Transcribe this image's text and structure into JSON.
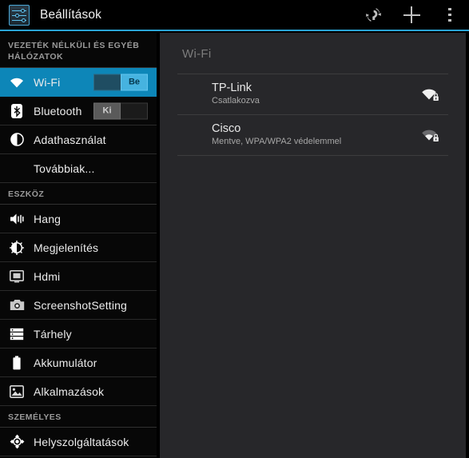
{
  "action_bar": {
    "app_icon": "settings-sliders-icon",
    "title": "Beállítások",
    "actions": [
      {
        "name": "scan-refresh-icon",
        "label": ""
      },
      {
        "name": "add-icon",
        "label": ""
      },
      {
        "name": "overflow-menu-icon",
        "label": ""
      }
    ]
  },
  "sidebar": {
    "sections": [
      {
        "header": "VEZETÉK NÉLKÜLI ÉS EGYÉB HÁLÓZATOK",
        "items": [
          {
            "label": "Wi-Fi",
            "icon": "wifi-icon",
            "selected": true,
            "toggle": {
              "state": "on",
              "label": "Be"
            }
          },
          {
            "label": "Bluetooth",
            "icon": "bluetooth-icon",
            "selected": false,
            "toggle": {
              "state": "off",
              "label": "Ki"
            }
          },
          {
            "label": "Adathasználat",
            "icon": "data-usage-icon",
            "selected": false
          },
          {
            "label": "Továbbiak...",
            "icon": "none",
            "selected": false
          }
        ]
      },
      {
        "header": "ESZKÖZ",
        "items": [
          {
            "label": "Hang",
            "icon": "sound-icon",
            "selected": false
          },
          {
            "label": "Megjelenítés",
            "icon": "display-brightness-icon",
            "selected": false
          },
          {
            "label": "Hdmi",
            "icon": "hdmi-screen-icon",
            "selected": false
          },
          {
            "label": "ScreenshotSetting",
            "icon": "camera-icon",
            "selected": false
          },
          {
            "label": "Tárhely",
            "icon": "storage-icon",
            "selected": false
          },
          {
            "label": "Akkumulátor",
            "icon": "battery-icon",
            "selected": false
          },
          {
            "label": "Alkalmazások",
            "icon": "apps-image-icon",
            "selected": false
          }
        ]
      },
      {
        "header": "SZEMÉLYES",
        "items": [
          {
            "label": "Helyszolgáltatások",
            "icon": "location-icon",
            "selected": false
          }
        ]
      }
    ]
  },
  "content": {
    "title": "Wi-Fi",
    "networks": [
      {
        "name": "TP-Link",
        "status": "Csatlakozva",
        "signal_icon": "wifi-signal-full-secured-icon",
        "signal_bars": 4,
        "secured": true
      },
      {
        "name": "Cisco",
        "status": "Mentve, WPA/WPA2 védelemmel",
        "signal_icon": "wifi-signal-low-secured-icon",
        "signal_bars": 2,
        "secured": true
      }
    ]
  },
  "colors": {
    "accent_blue": "#0d86b8",
    "bar_underline": "#2aa5d6",
    "sidebar_bg": "#070707",
    "content_bg": "#27272a",
    "toggle_on": "#46b3e0",
    "toggle_off": "#5a5a5a"
  }
}
